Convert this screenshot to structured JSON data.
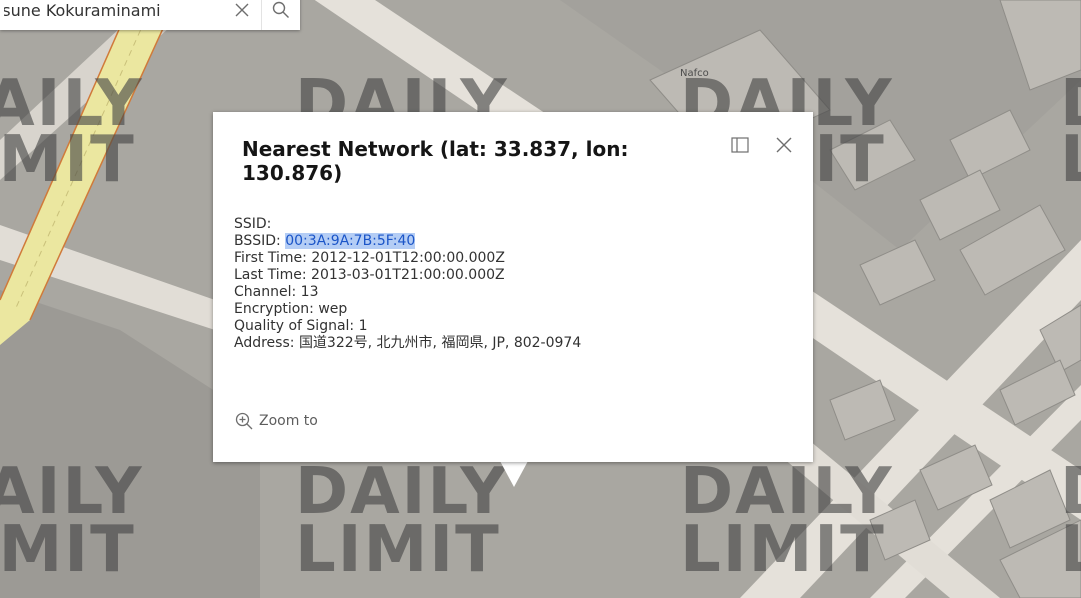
{
  "search": {
    "value": "tsune Kokuraminami",
    "clear_icon": "close-icon",
    "search_icon": "search-icon"
  },
  "map": {
    "label_nafco": "Nafco",
    "watermark": {
      "line1": "DAILY",
      "line2": "LIMIT"
    }
  },
  "popup": {
    "title": "Nearest Network (lat: 33.837, lon: 130.876)",
    "dock_icon": "dock-icon",
    "close_icon": "close-icon",
    "fields": [
      {
        "label": "SSID:",
        "value": ""
      },
      {
        "label": "BSSID:",
        "value": "00:3A:9A:7B:5F:40",
        "highlighted": true
      },
      {
        "label": "First Time:",
        "value": "2012-12-01T12:00:00.000Z"
      },
      {
        "label": "Last Time:",
        "value": "2013-03-01T21:00:00.000Z"
      },
      {
        "label": "Channel:",
        "value": "13"
      },
      {
        "label": "Encryption:",
        "value": "wep"
      },
      {
        "label": "Quality of Signal:",
        "value": "1"
      },
      {
        "label": "Address:",
        "value": "国道322号, 北九州市, 福岡県, JP, 802-0974"
      }
    ],
    "zoom_label": "Zoom to",
    "zoom_icon": "zoom-in-icon"
  },
  "colors": {
    "map_bg": "#a9a7a1",
    "building": "#bdbab4",
    "road": "#e5e1da",
    "highway": "#ebe7a0",
    "highway_edge": "#d07a3a",
    "selection": "#b4cdf5"
  }
}
